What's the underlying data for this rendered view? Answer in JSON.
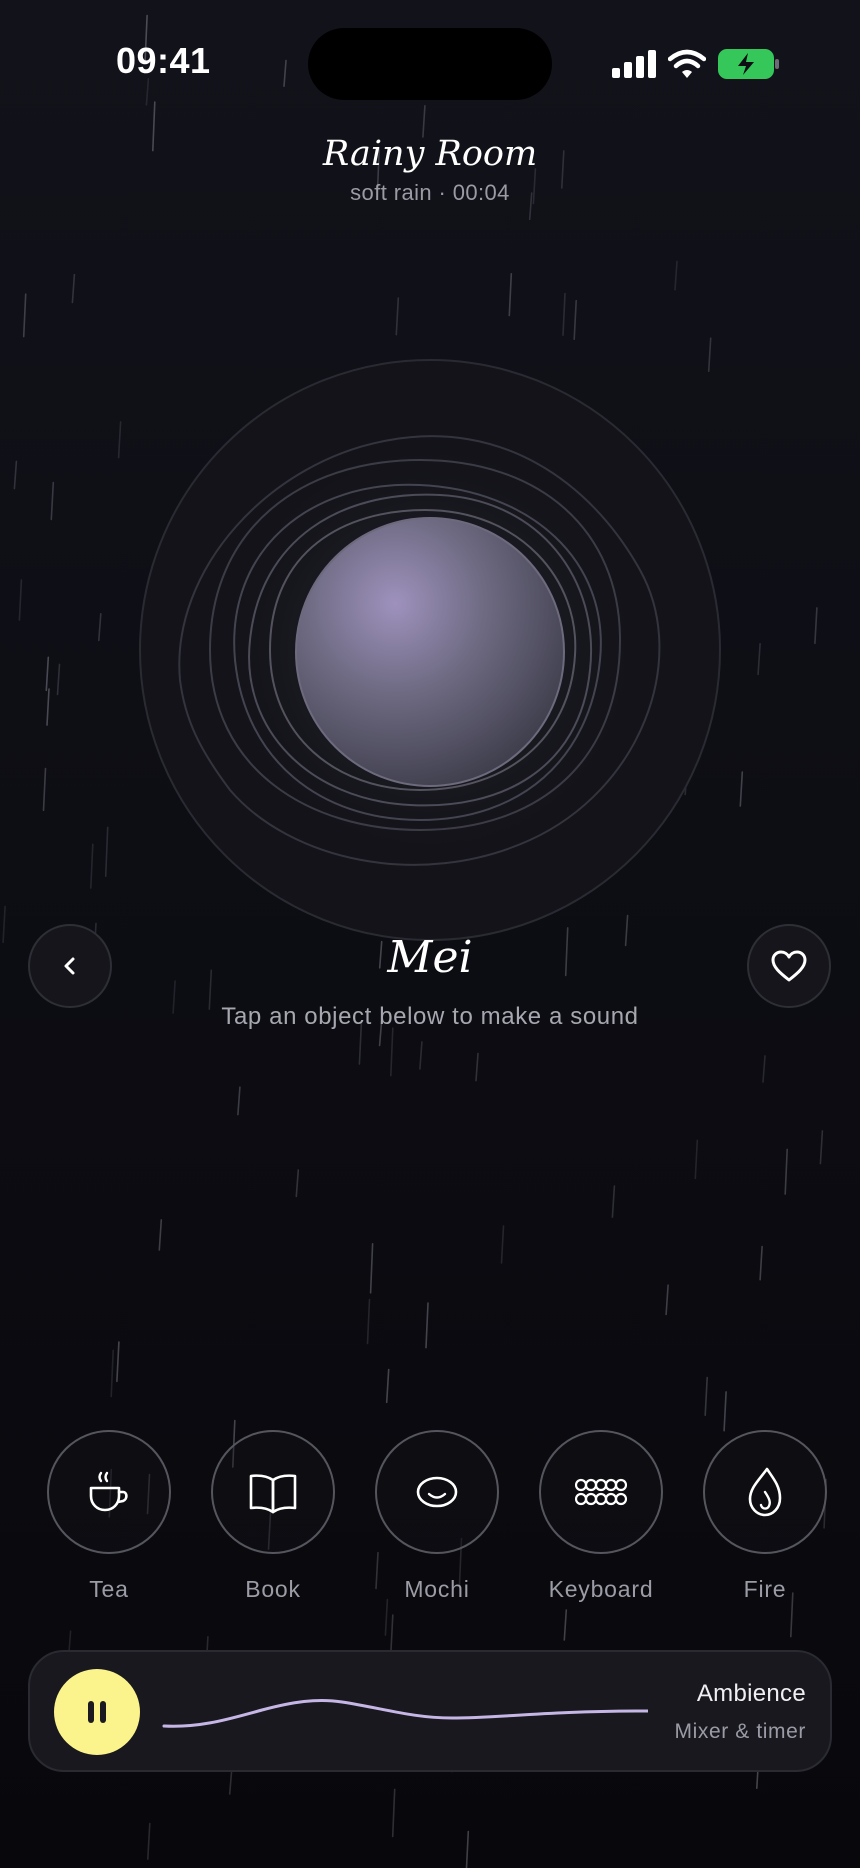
{
  "status_bar": {
    "time": "09:41",
    "icons": [
      "cellular-signal-icon",
      "wifi-icon",
      "battery-charging-icon"
    ],
    "battery_color": "#35c759"
  },
  "header": {
    "title": "Rainy Room",
    "subtitle": "soft rain · 00:04"
  },
  "character": {
    "name": "Mei",
    "hint": "Tap an object below to make a sound",
    "back_icon": "chevron-left-icon",
    "favorite_icon": "heart-icon"
  },
  "objects": [
    {
      "label": "Tea",
      "icon": "tea-cup-icon"
    },
    {
      "label": "Book",
      "icon": "open-book-icon"
    },
    {
      "label": "Mochi",
      "icon": "mochi-icon"
    },
    {
      "label": "Keyboard",
      "icon": "keyboard-keys-icon"
    },
    {
      "label": "Fire",
      "icon": "flame-icon"
    }
  ],
  "player": {
    "state_icon": "pause-icon",
    "title": "Ambience",
    "subtitle": "Mixer & timer"
  },
  "colors": {
    "background": "#0d0d14",
    "accent_yellow": "#fbf38c",
    "wave_lavender": "#c5b6e6",
    "orb_lavender": "#9e92bd"
  }
}
